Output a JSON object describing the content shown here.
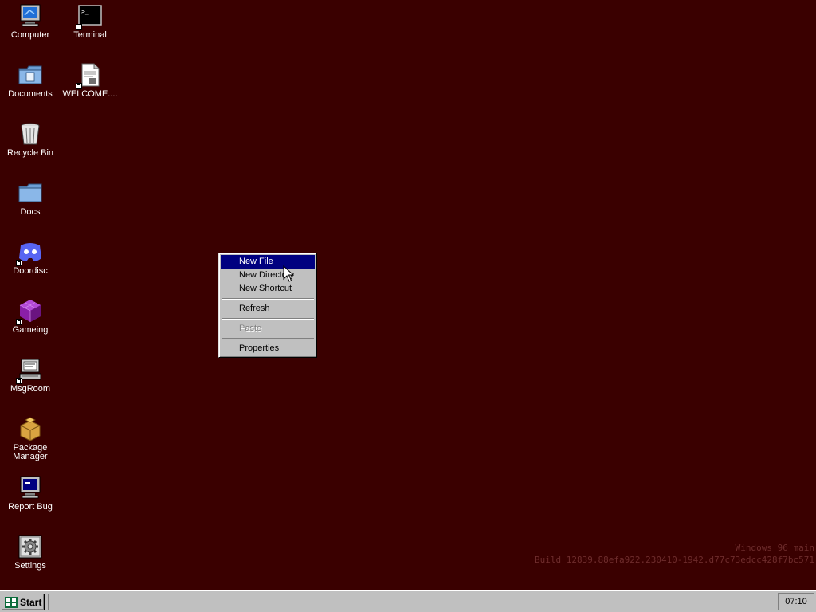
{
  "desktop": {
    "background_color": "#3a0000",
    "icons": [
      {
        "label": "Computer",
        "icon": "computer-icon"
      },
      {
        "label": "Terminal",
        "icon": "terminal-icon"
      },
      {
        "label": "Documents",
        "icon": "documents-folder-icon"
      },
      {
        "label": "WELCOME....",
        "icon": "text-document-icon"
      },
      {
        "label": "Recycle Bin",
        "icon": "recycle-bin-icon"
      },
      {
        "label": "Docs",
        "icon": "folder-icon"
      },
      {
        "label": "Doordisc",
        "icon": "doordisc-icon"
      },
      {
        "label": "Gameing",
        "icon": "game-cube-icon"
      },
      {
        "label": "MsgRoom",
        "icon": "msgroom-icon"
      },
      {
        "label": "Package Manager",
        "icon": "package-icon"
      },
      {
        "label": "Report Bug",
        "icon": "bug-report-computer-icon"
      },
      {
        "label": "Settings",
        "icon": "settings-gear-icon"
      }
    ]
  },
  "context_menu": {
    "items": [
      {
        "label": "New File",
        "state": "highlighted"
      },
      {
        "label": "New Directory",
        "state": "normal"
      },
      {
        "label": "New Shortcut",
        "state": "normal"
      },
      {
        "label": "Refresh",
        "state": "normal"
      },
      {
        "label": "Paste",
        "state": "disabled"
      },
      {
        "label": "Properties",
        "state": "normal"
      }
    ],
    "highlight_color": "#000080"
  },
  "watermark": {
    "line1": "Windows 96 main",
    "line2": "Build 12839.88efa922.230410-1942.d77c73edcc428f7bc571"
  },
  "taskbar": {
    "start_label": "Start",
    "clock": "07:10"
  }
}
